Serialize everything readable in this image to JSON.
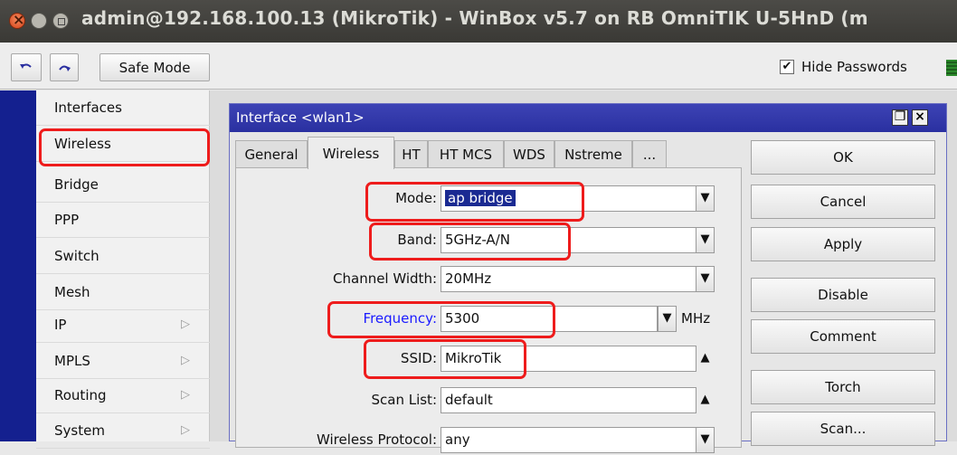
{
  "window": {
    "title": "admin@192.168.100.13 (MikroTik) - WinBox v5.7 on RB OmniTIK U-5HnD (m"
  },
  "toolbar": {
    "undo_icon": "undo-icon",
    "redo_icon": "redo-icon",
    "safe_mode_label": "Safe Mode",
    "hide_passwords_label": "Hide Passwords",
    "hide_passwords_checked": "✔"
  },
  "sidebar": {
    "items": [
      {
        "label": "Interfaces",
        "submenu": false
      },
      {
        "label": "Wireless",
        "submenu": false
      },
      {
        "label": "Bridge",
        "submenu": false
      },
      {
        "label": "PPP",
        "submenu": false
      },
      {
        "label": "Switch",
        "submenu": false
      },
      {
        "label": "Mesh",
        "submenu": false
      },
      {
        "label": "IP",
        "submenu": true
      },
      {
        "label": "MPLS",
        "submenu": true
      },
      {
        "label": "Routing",
        "submenu": true
      },
      {
        "label": "System",
        "submenu": true
      }
    ],
    "submenu_glyph": "▷"
  },
  "dialog": {
    "title": "Interface <wlan1>",
    "restore_glyph": "❐",
    "close_glyph": "×",
    "tabs": [
      "General",
      "Wireless",
      "HT",
      "HT MCS",
      "WDS",
      "Nstreme",
      "..."
    ],
    "active_tab": "Wireless",
    "fields": {
      "mode": {
        "label": "Mode:",
        "value": "ap bridge"
      },
      "band": {
        "label": "Band:",
        "value": "5GHz-A/N"
      },
      "channel_width": {
        "label": "Channel Width:",
        "value": "20MHz"
      },
      "frequency": {
        "label": "Frequency:",
        "value": "5300",
        "unit": "MHz"
      },
      "ssid": {
        "label": "SSID:",
        "value": "MikroTik"
      },
      "scan_list": {
        "label": "Scan List:",
        "value": "default"
      },
      "wireless_protocol": {
        "label": "Wireless Protocol:",
        "value": "any"
      }
    },
    "buttons": [
      "OK",
      "Cancel",
      "Apply",
      "Disable",
      "Comment",
      "Torch",
      "Scan..."
    ]
  },
  "colors": {
    "highlight": "#ee1c1c",
    "dialog_title_bg": "#2a30a0",
    "sidebar_strip": "#14208f",
    "frequency_label": "#1a1aff"
  }
}
